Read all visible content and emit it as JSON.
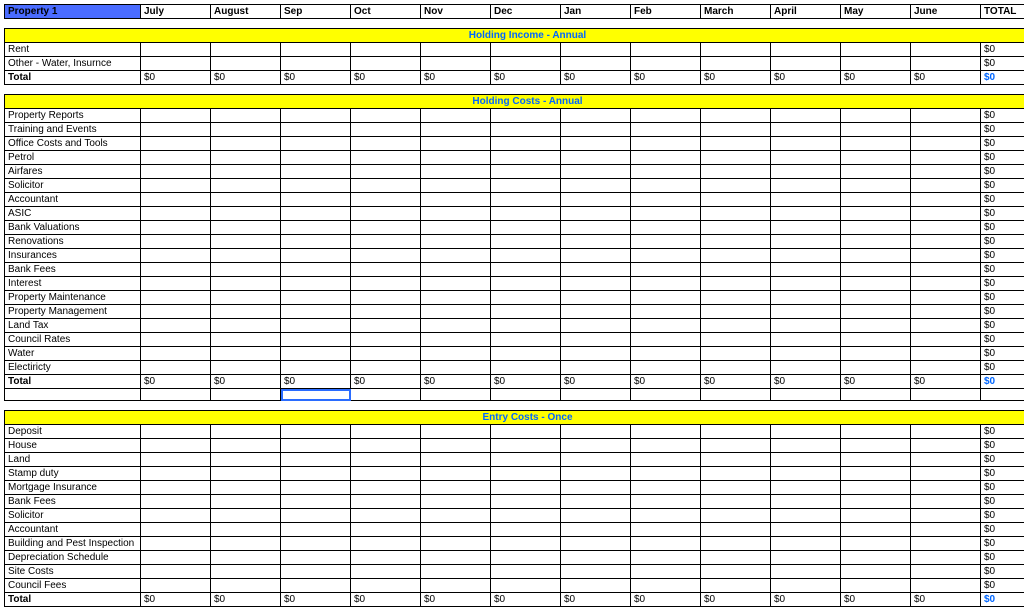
{
  "header": {
    "property_label": "Property 1",
    "months": [
      "July",
      "August",
      "Sep",
      "Oct",
      "Nov",
      "Dec",
      "Jan",
      "Feb",
      "March",
      "April",
      "May",
      "June"
    ],
    "total_label": "TOTAL"
  },
  "sections": [
    {
      "title": "Holding Income - Annual",
      "rows": [
        {
          "label": "Rent",
          "cells": [
            "",
            "",
            "",
            "",
            "",
            "",
            "",
            "",
            "",
            "",
            "",
            ""
          ],
          "total": "$0"
        },
        {
          "label": "Other - Water, Insurnce",
          "cells": [
            "",
            "",
            "",
            "",
            "",
            "",
            "",
            "",
            "",
            "",
            "",
            ""
          ],
          "total": "$0"
        }
      ],
      "total": {
        "label": "Total",
        "cells": [
          "$0",
          "$0",
          "$0",
          "$0",
          "$0",
          "$0",
          "$0",
          "$0",
          "$0",
          "$0",
          "$0",
          "$0"
        ],
        "total": "$0"
      }
    },
    {
      "title": "Holding Costs - Annual",
      "rows": [
        {
          "label": "Property Reports",
          "cells": [
            "",
            "",
            "",
            "",
            "",
            "",
            "",
            "",
            "",
            "",
            "",
            ""
          ],
          "total": "$0"
        },
        {
          "label": "Training and Events",
          "cells": [
            "",
            "",
            "",
            "",
            "",
            "",
            "",
            "",
            "",
            "",
            "",
            ""
          ],
          "total": "$0"
        },
        {
          "label": "Office Costs and Tools",
          "cells": [
            "",
            "",
            "",
            "",
            "",
            "",
            "",
            "",
            "",
            "",
            "",
            ""
          ],
          "total": "$0"
        },
        {
          "label": "Petrol",
          "cells": [
            "",
            "",
            "",
            "",
            "",
            "",
            "",
            "",
            "",
            "",
            "",
            ""
          ],
          "total": "$0"
        },
        {
          "label": "Airfares",
          "cells": [
            "",
            "",
            "",
            "",
            "",
            "",
            "",
            "",
            "",
            "",
            "",
            ""
          ],
          "total": "$0"
        },
        {
          "label": "Solicitor",
          "cells": [
            "",
            "",
            "",
            "",
            "",
            "",
            "",
            "",
            "",
            "",
            "",
            ""
          ],
          "total": "$0"
        },
        {
          "label": "Accountant",
          "cells": [
            "",
            "",
            "",
            "",
            "",
            "",
            "",
            "",
            "",
            "",
            "",
            ""
          ],
          "total": "$0"
        },
        {
          "label": "ASIC",
          "cells": [
            "",
            "",
            "",
            "",
            "",
            "",
            "",
            "",
            "",
            "",
            "",
            ""
          ],
          "total": "$0"
        },
        {
          "label": "Bank Valuations",
          "cells": [
            "",
            "",
            "",
            "",
            "",
            "",
            "",
            "",
            "",
            "",
            "",
            ""
          ],
          "total": "$0"
        },
        {
          "label": "Renovations",
          "cells": [
            "",
            "",
            "",
            "",
            "",
            "",
            "",
            "",
            "",
            "",
            "",
            ""
          ],
          "total": "$0"
        },
        {
          "label": "Insurances",
          "cells": [
            "",
            "",
            "",
            "",
            "",
            "",
            "",
            "",
            "",
            "",
            "",
            ""
          ],
          "total": "$0"
        },
        {
          "label": "Bank Fees",
          "cells": [
            "",
            "",
            "",
            "",
            "",
            "",
            "",
            "",
            "",
            "",
            "",
            ""
          ],
          "total": "$0"
        },
        {
          "label": "Interest",
          "cells": [
            "",
            "",
            "",
            "",
            "",
            "",
            "",
            "",
            "",
            "",
            "",
            ""
          ],
          "total": "$0"
        },
        {
          "label": "Property Maintenance",
          "cells": [
            "",
            "",
            "",
            "",
            "",
            "",
            "",
            "",
            "",
            "",
            "",
            ""
          ],
          "total": "$0"
        },
        {
          "label": "Property Management",
          "cells": [
            "",
            "",
            "",
            "",
            "",
            "",
            "",
            "",
            "",
            "",
            "",
            ""
          ],
          "total": "$0"
        },
        {
          "label": "Land Tax",
          "cells": [
            "",
            "",
            "",
            "",
            "",
            "",
            "",
            "",
            "",
            "",
            "",
            ""
          ],
          "total": "$0"
        },
        {
          "label": "Council Rates",
          "cells": [
            "",
            "",
            "",
            "",
            "",
            "",
            "",
            "",
            "",
            "",
            "",
            ""
          ],
          "total": "$0"
        },
        {
          "label": "Water",
          "cells": [
            "",
            "",
            "",
            "",
            "",
            "",
            "",
            "",
            "",
            "",
            "",
            ""
          ],
          "total": "$0"
        },
        {
          "label": "Electiricty",
          "cells": [
            "",
            "",
            "",
            "",
            "",
            "",
            "",
            "",
            "",
            "",
            "",
            ""
          ],
          "total": "$0"
        }
      ],
      "total": {
        "label": "Total",
        "cells": [
          "$0",
          "$0",
          "$0",
          "$0",
          "$0",
          "$0",
          "$0",
          "$0",
          "$0",
          "$0",
          "$0",
          "$0"
        ],
        "total": "$0"
      }
    },
    {
      "title": "Entry Costs - Once",
      "rows": [
        {
          "label": "Deposit",
          "cells": [
            "",
            "",
            "",
            "",
            "",
            "",
            "",
            "",
            "",
            "",
            "",
            ""
          ],
          "total": "$0"
        },
        {
          "label": "House",
          "cells": [
            "",
            "",
            "",
            "",
            "",
            "",
            "",
            "",
            "",
            "",
            "",
            ""
          ],
          "total": "$0"
        },
        {
          "label": "Land",
          "cells": [
            "",
            "",
            "",
            "",
            "",
            "",
            "",
            "",
            "",
            "",
            "",
            ""
          ],
          "total": "$0"
        },
        {
          "label": "Stamp duty",
          "cells": [
            "",
            "",
            "",
            "",
            "",
            "",
            "",
            "",
            "",
            "",
            "",
            ""
          ],
          "total": "$0"
        },
        {
          "label": "Mortgage Insurance",
          "cells": [
            "",
            "",
            "",
            "",
            "",
            "",
            "",
            "",
            "",
            "",
            "",
            ""
          ],
          "total": "$0"
        },
        {
          "label": "Bank Fees",
          "cells": [
            "",
            "",
            "",
            "",
            "",
            "",
            "",
            "",
            "",
            "",
            "",
            ""
          ],
          "total": "$0"
        },
        {
          "label": "Solicitor",
          "cells": [
            "",
            "",
            "",
            "",
            "",
            "",
            "",
            "",
            "",
            "",
            "",
            ""
          ],
          "total": "$0"
        },
        {
          "label": "Accountant",
          "cells": [
            "",
            "",
            "",
            "",
            "",
            "",
            "",
            "",
            "",
            "",
            "",
            ""
          ],
          "total": "$0"
        },
        {
          "label": "Building and Pest Inspection",
          "cells": [
            "",
            "",
            "",
            "",
            "",
            "",
            "",
            "",
            "",
            "",
            "",
            ""
          ],
          "total": "$0"
        },
        {
          "label": "Depreciation Schedule",
          "cells": [
            "",
            "",
            "",
            "",
            "",
            "",
            "",
            "",
            "",
            "",
            "",
            ""
          ],
          "total": "$0"
        },
        {
          "label": "Site Costs",
          "cells": [
            "",
            "",
            "",
            "",
            "",
            "",
            "",
            "",
            "",
            "",
            "",
            ""
          ],
          "total": "$0"
        },
        {
          "label": "Council Fees",
          "cells": [
            "",
            "",
            "",
            "",
            "",
            "",
            "",
            "",
            "",
            "",
            "",
            ""
          ],
          "total": "$0"
        }
      ],
      "total": {
        "label": "Total",
        "cells": [
          "$0",
          "$0",
          "$0",
          "$0",
          "$0",
          "$0",
          "$0",
          "$0",
          "$0",
          "$0",
          "$0",
          "$0"
        ],
        "total": "$0"
      }
    }
  ],
  "selected_cell": {
    "section": 1,
    "after_total": true,
    "col": 3
  }
}
